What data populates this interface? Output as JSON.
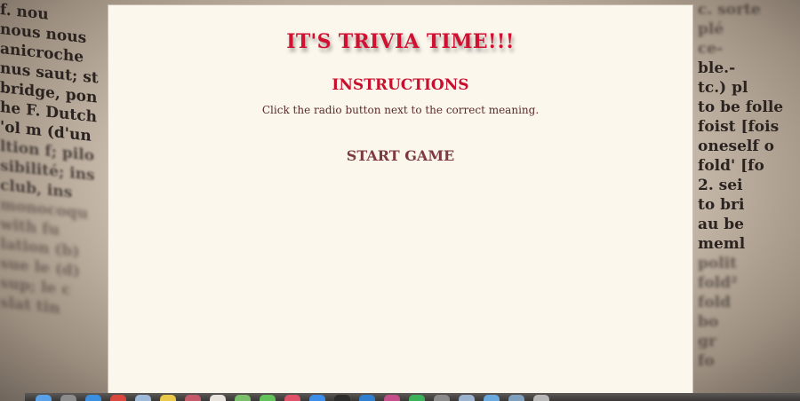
{
  "background": {
    "left_lines": [
      "f. nou",
      "nous nous",
      "anicroche",
      "nus saut; st",
      "bridge, pon",
      "he F. Dutch",
      "'ol m (d'un",
      "ltion f; pilo",
      "sibilité; ins",
      "club, ins",
      "monocoqu",
      "with fu",
      "lation (b)",
      "sue le (d)",
      "sup; le c",
      "slat tin"
    ],
    "right_lines": [
      "c. sorte",
      "plé",
      "ce-",
      "ble.-",
      "tc.) pl",
      "to be folle",
      "foist [fois",
      "oneself o",
      "fold' [fo",
      "2. sei",
      "to bri",
      "au be",
      "meml",
      "polit",
      "fold²",
      "fold",
      "bo",
      "gr",
      "fo"
    ]
  },
  "panel": {
    "title": "IT'S TRIVIA TIME!!!",
    "instructions_heading": "INSTRUCTIONS",
    "instructions_text": "Click the radio button next to the correct meaning.",
    "start_label": "START GAME"
  },
  "colors": {
    "title": "#d11131",
    "heading": "#c8102e",
    "start": "#7d3a3f",
    "panel_bg": "#fbf7ed"
  },
  "dock": {
    "icons": [
      {
        "name": "finder-icon",
        "color": "#5aa0e6"
      },
      {
        "name": "launchpad-icon",
        "color": "#8c8c8c"
      },
      {
        "name": "safari-icon",
        "color": "#3b8fe0"
      },
      {
        "name": "chrome-icon",
        "color": "#d9473f"
      },
      {
        "name": "mail-icon",
        "color": "#9fb9d8"
      },
      {
        "name": "notes-icon",
        "color": "#e9c84a"
      },
      {
        "name": "photos-icon",
        "color": "#c45a6a"
      },
      {
        "name": "calendar-icon",
        "color": "#e8e3dc"
      },
      {
        "name": "maps-icon",
        "color": "#7bbf6a"
      },
      {
        "name": "messages-icon",
        "color": "#61c15a"
      },
      {
        "name": "music-icon",
        "color": "#e0526a"
      },
      {
        "name": "app-store-icon",
        "color": "#3d8ee8"
      },
      {
        "name": "terminal-icon",
        "color": "#2c2c2c"
      },
      {
        "name": "vscode-icon",
        "color": "#2f7fd1"
      },
      {
        "name": "slack-icon",
        "color": "#c44f8a"
      },
      {
        "name": "spotify-icon",
        "color": "#3bb25a"
      },
      {
        "name": "settings-icon",
        "color": "#8a8a8a"
      },
      {
        "name": "preview-icon",
        "color": "#9bb3cf"
      },
      {
        "name": "folder-icon",
        "color": "#6aa9e0"
      },
      {
        "name": "downloads-icon",
        "color": "#7f9fbf"
      },
      {
        "name": "trash-icon",
        "color": "#b7b7b7"
      }
    ]
  }
}
